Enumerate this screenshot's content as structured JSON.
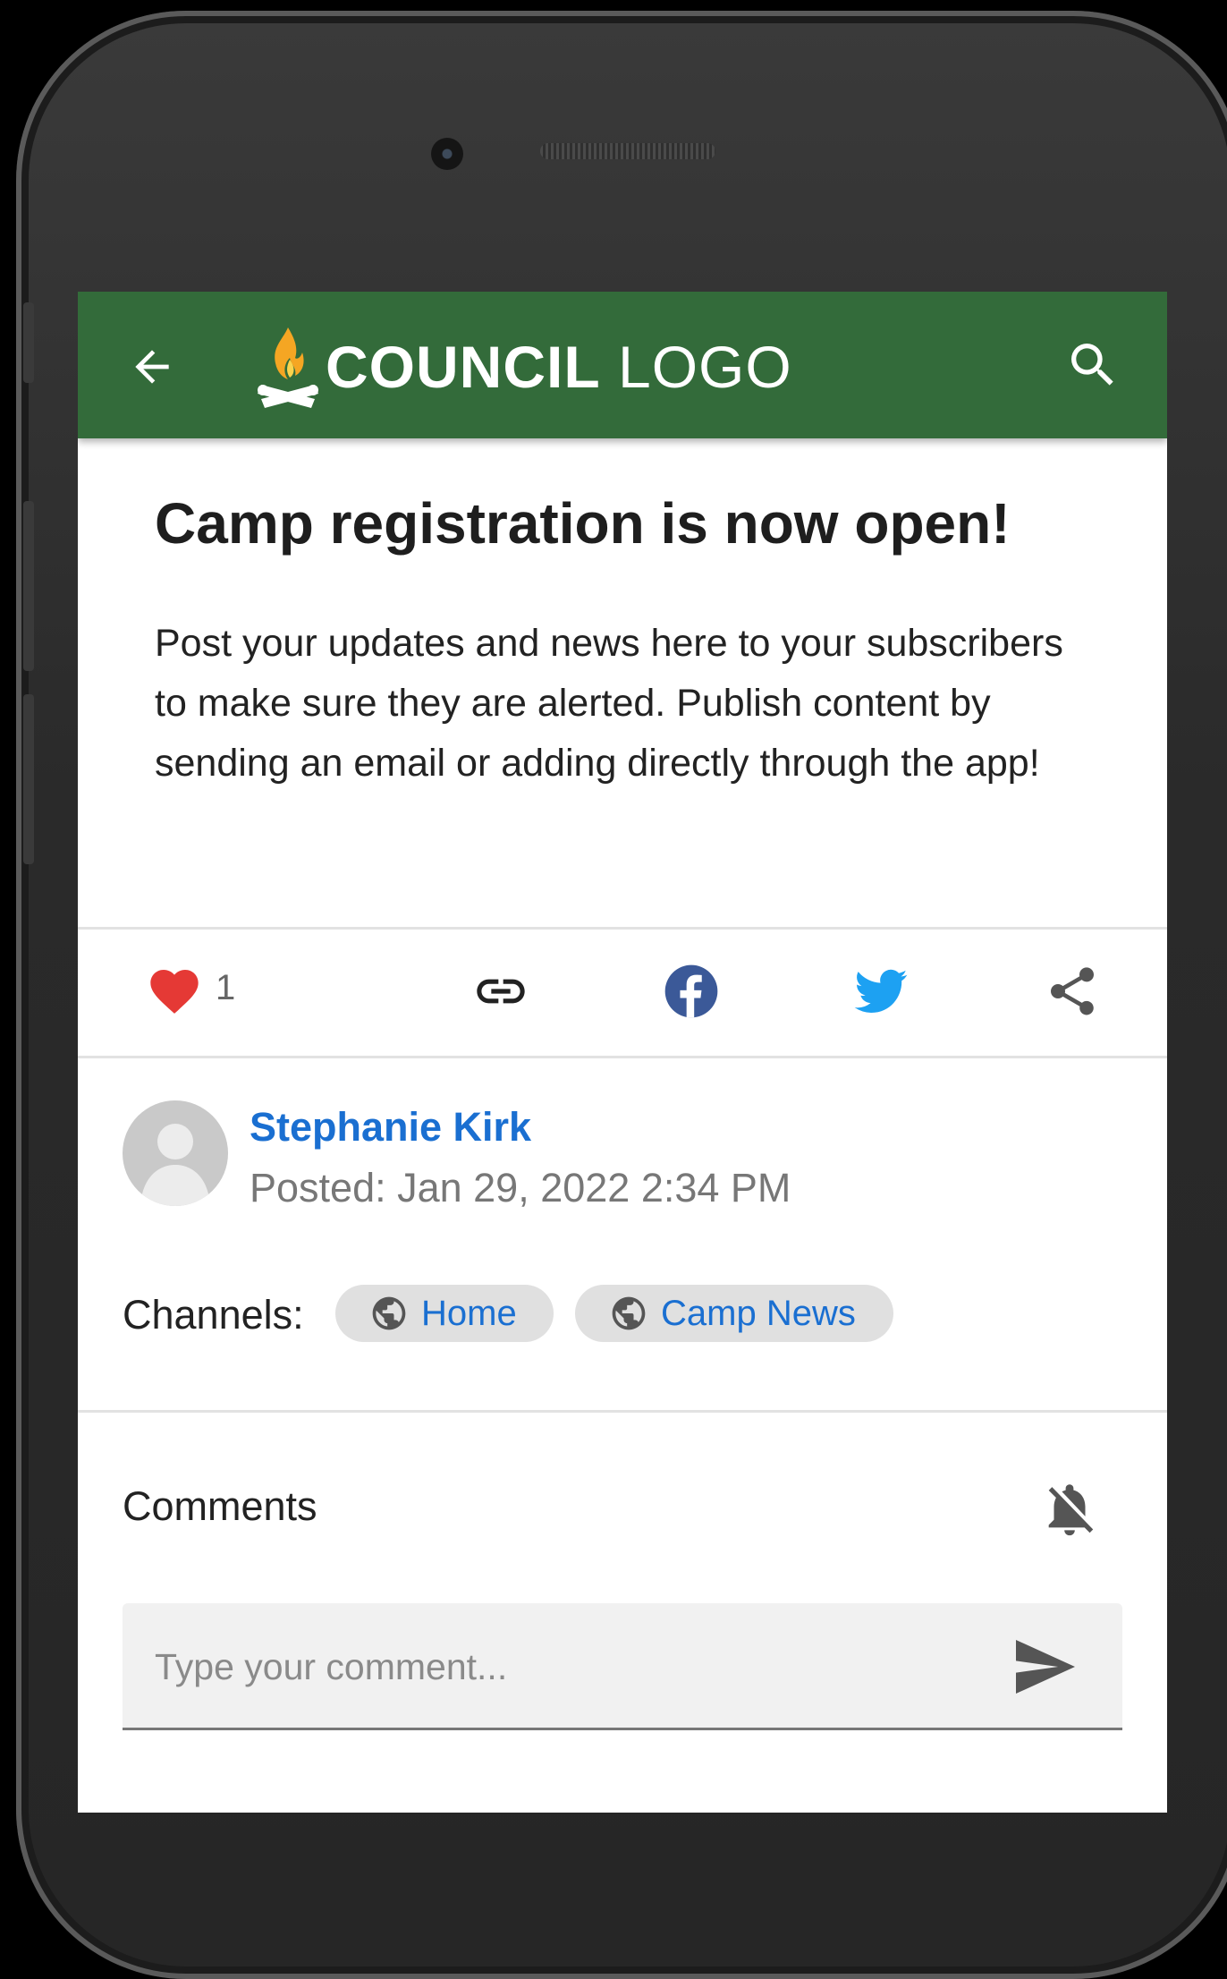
{
  "app": {
    "logo_bold": "COUNCIL",
    "logo_light": " LOGO"
  },
  "post": {
    "title": "Camp registration is now open!",
    "body": "Post your updates and news here to your subscribers to make sure they are alerted. Publish content by sending an email or adding directly through the app!",
    "like_count": "1"
  },
  "author": {
    "name": "Stephanie Kirk",
    "posted": "Posted: Jan 29, 2022 2:34 PM"
  },
  "channels": {
    "label": "Channels:",
    "items": [
      {
        "label": "Home"
      },
      {
        "label": "Camp News"
      }
    ]
  },
  "comments": {
    "label": "Comments",
    "placeholder": "Type your comment..."
  },
  "colors": {
    "appbar": "#336b3a",
    "link": "#1a6fd1",
    "heart": "#e53935",
    "facebook": "#3b5998",
    "twitter": "#1da1f2"
  },
  "icons": [
    "back-arrow-icon",
    "campfire-logo-icon",
    "search-icon",
    "heart-icon",
    "link-icon",
    "facebook-icon",
    "twitter-icon",
    "share-icon",
    "globe-icon",
    "bell-off-icon",
    "send-icon"
  ]
}
